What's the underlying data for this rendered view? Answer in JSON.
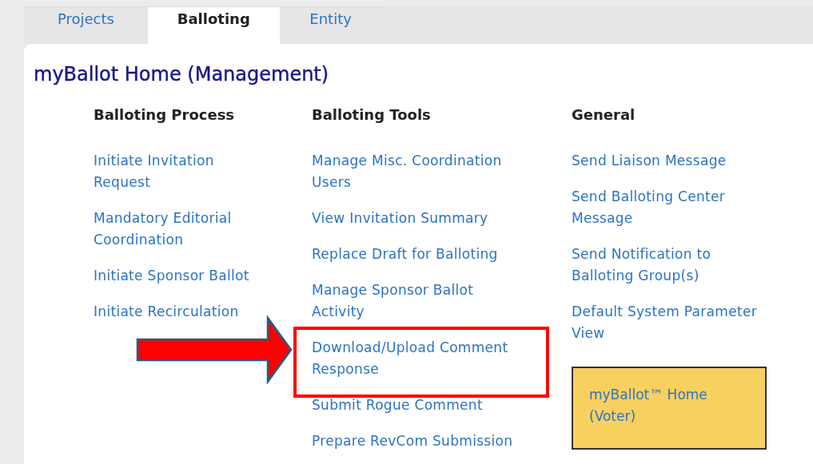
{
  "tabs": [
    {
      "label": "Projects",
      "selected": false
    },
    {
      "label": "Balloting",
      "selected": true
    },
    {
      "label": "Entity",
      "selected": false
    }
  ],
  "title": "myBallot Home (Management)",
  "columns": [
    {
      "heading": "Balloting Process",
      "links": [
        {
          "text": "Initiate Invitation\nRequest",
          "highlighted": false
        },
        {
          "text": "Mandatory Editorial\nCoordination",
          "highlighted": false
        },
        {
          "text": "Initiate Sponsor Ballot",
          "highlighted": false
        },
        {
          "text": "Initiate Recirculation",
          "highlighted": false
        }
      ]
    },
    {
      "heading": "Balloting Tools",
      "links": [
        {
          "text": "Manage Misc. Coordination\nUsers",
          "highlighted": false
        },
        {
          "text": "View Invitation Summary",
          "highlighted": false
        },
        {
          "text": "Replace Draft for Balloting",
          "highlighted": false
        },
        {
          "text": "Manage Sponsor Ballot\nActivity",
          "highlighted": false
        },
        {
          "text": "Download/Upload Comment\nResponse",
          "highlighted": true
        },
        {
          "text": "Submit Rogue Comment",
          "highlighted": false
        },
        {
          "text": "Prepare RevCom Submission",
          "highlighted": false
        }
      ]
    },
    {
      "heading": "General",
      "links": [
        {
          "text": "Send Liaison Message",
          "highlighted": false
        },
        {
          "text": "Send Balloting Center\nMessage",
          "highlighted": false
        },
        {
          "text": "Send Notification to\nBalloting Group(s)",
          "highlighted": false
        },
        {
          "text": "Default System Parameter\nView",
          "highlighted": false
        }
      ],
      "button": "myBallot™ Home\n(Voter)"
    }
  ]
}
